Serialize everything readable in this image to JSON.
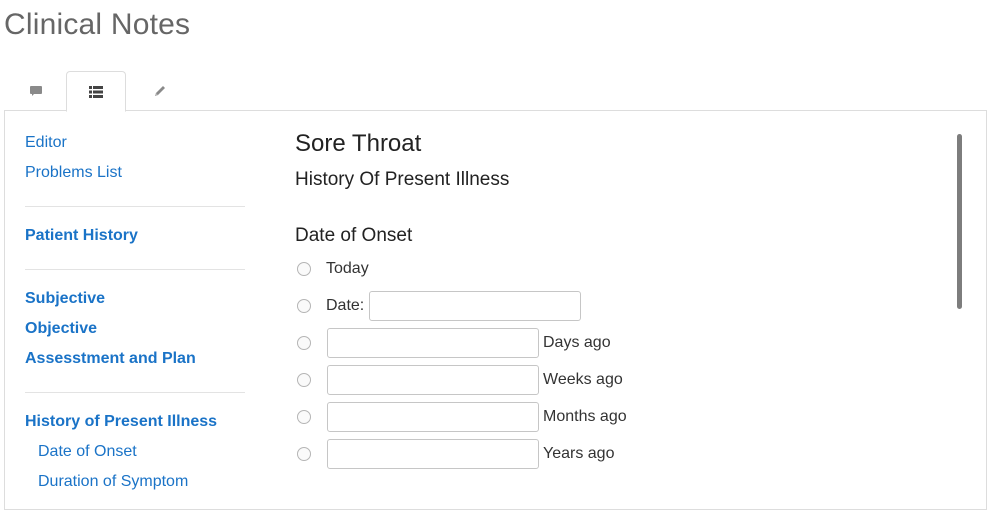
{
  "page": {
    "title": "Clinical Notes"
  },
  "tabs": [
    {
      "icon": "comment-icon",
      "active": false
    },
    {
      "icon": "list-icon",
      "active": true
    },
    {
      "icon": "pencil-icon",
      "active": false
    }
  ],
  "sidebar": {
    "top_links": [
      "Editor",
      "Problems List"
    ],
    "patient_history": "Patient History",
    "soap": [
      "Subjective",
      "Objective",
      "Assesstment and Plan"
    ],
    "hpi": "History of Present Illness",
    "hpi_sub": [
      "Date of Onset",
      "Duration of Symptom"
    ]
  },
  "main": {
    "title": "Sore Throat",
    "subtitle": "History Of Present Illness",
    "section": "Date of Onset",
    "options": {
      "today": "Today",
      "date": "Date:",
      "days": "Days ago",
      "weeks": "Weeks ago",
      "months": "Months ago",
      "years": "Years ago"
    },
    "values": {
      "date": "",
      "days": "",
      "weeks": "",
      "months": "",
      "years": ""
    }
  },
  "colors": {
    "link": "#1a73c7",
    "border": "#dddddd"
  }
}
